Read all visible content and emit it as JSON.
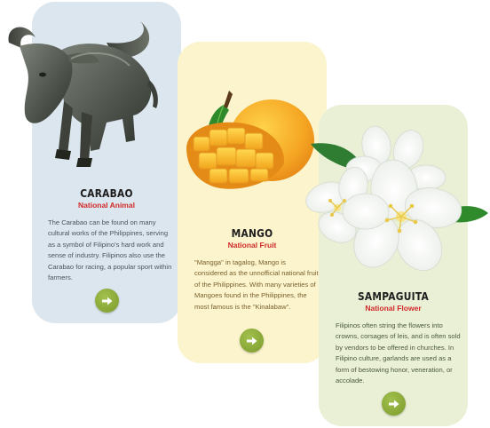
{
  "cards": [
    {
      "title": "CARABAO",
      "subtitle": "National Animal",
      "description": "The Carabao can be found on many cultural works of the Philippines, serving as a symbol of Filipino's hard work and sense of industry. Filipinos also use the Carabao for racing, a popular sport within farmers.",
      "bg_color": "#dce6ee",
      "text_color": "#4a5560",
      "icon": "arrow-right-icon"
    },
    {
      "title": "MANGO",
      "subtitle": "National Fruit",
      "description": "\"Mangga\" in tagalog, Mango is considered as the unnofficial national fruit of the Philippines. With many varieties of Mangoes found in the Philippines, the most famous is the \"Kinalabaw\".",
      "bg_color": "#fbf4cc",
      "text_color": "#7a6130",
      "icon": "arrow-right-icon"
    },
    {
      "title": "SAMPAGUITA",
      "subtitle": "National Flower",
      "description": "Filipinos often string the flowers into crowns, corsages of leis, and is often sold by vendors to be offered in churches. In Filipino culture, garlands are used as a form of bestowing honor, veneration, or accolade.",
      "bg_color": "#eaf0d6",
      "text_color": "#4b5a3a",
      "icon": "arrow-right-icon"
    }
  ],
  "accent_color": "#8aab35",
  "subtitle_color": "#d12a2a"
}
